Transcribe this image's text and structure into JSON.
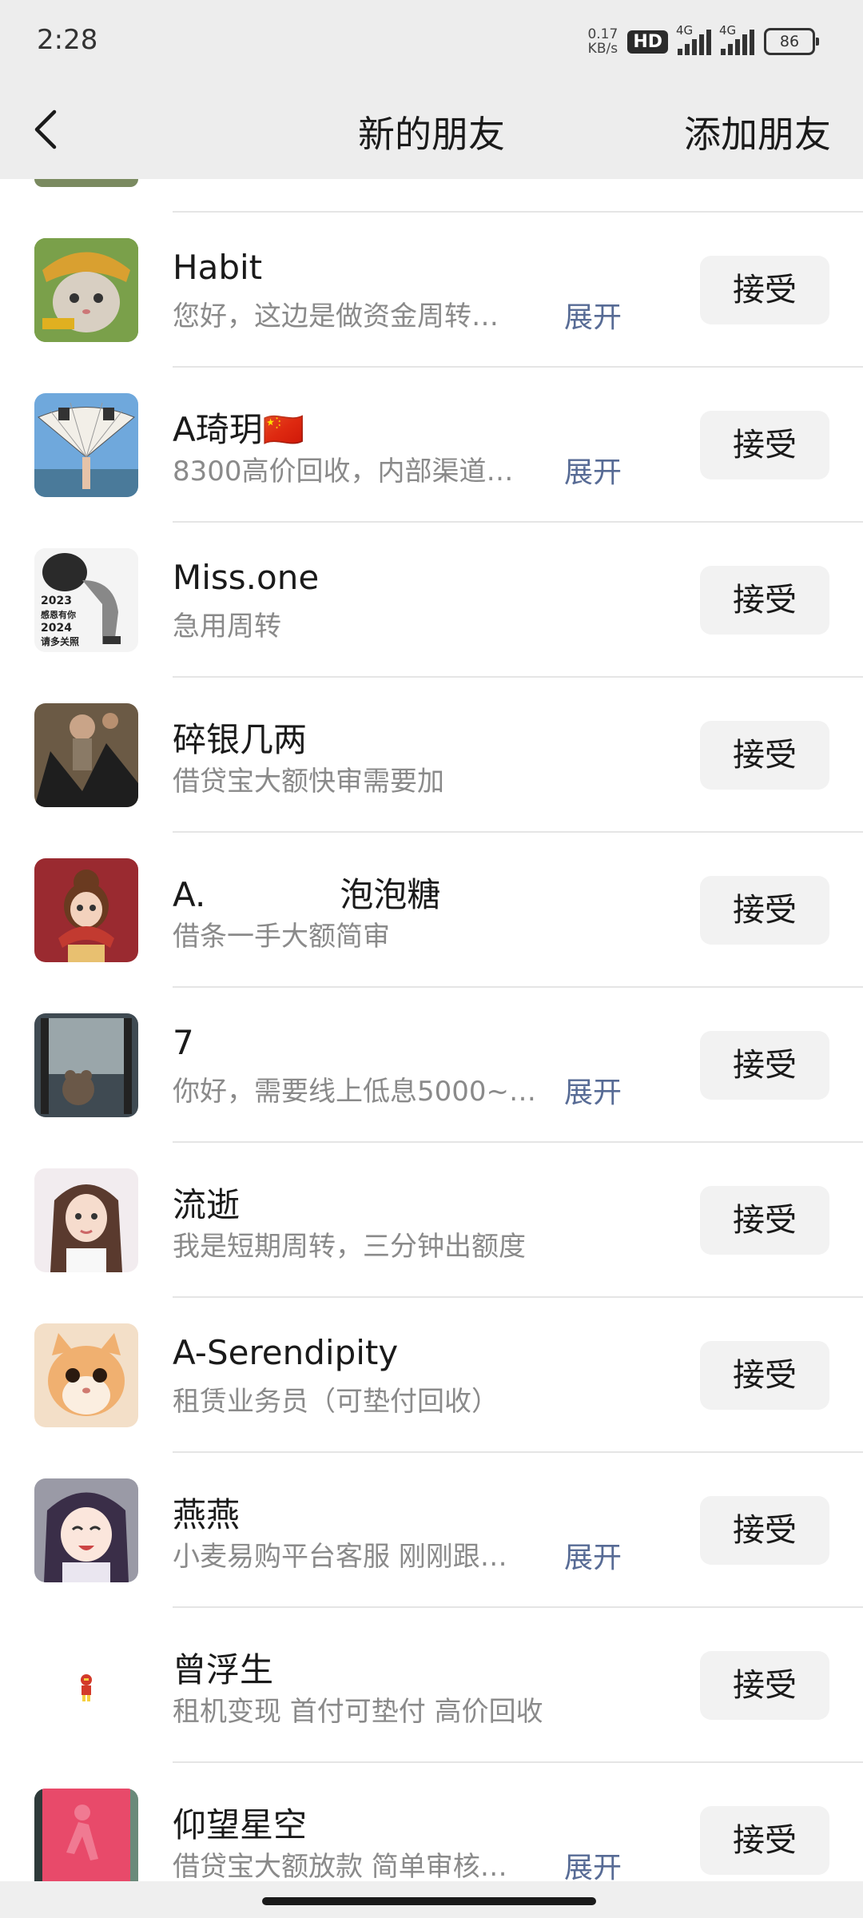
{
  "status_bar": {
    "time": "2:28",
    "net_speed_value": "0.17",
    "net_speed_unit": "KB/s",
    "hd_badge": "HD",
    "signal_1_label": "4G",
    "signal_2_label": "4G",
    "battery": "86"
  },
  "nav": {
    "title": "新的朋友",
    "add_label": "添加朋友"
  },
  "requests": [
    {
      "name": "Habit",
      "message": "您好，这边是做资金周转…",
      "expand": "展开",
      "accept": "接受"
    },
    {
      "name": "A琦玥🇨🇳",
      "message": "8300高价回收，内部渠道…",
      "expand": "展开",
      "accept": "接受"
    },
    {
      "name": "Miss.one",
      "message": "急用周转",
      "expand": "",
      "accept": "接受"
    },
    {
      "name": "碎银几两",
      "message": "借贷宝大额快审需要加",
      "expand": "",
      "accept": "接受"
    },
    {
      "name": "A.　　　　泡泡糖",
      "message": "借条一手大额简审",
      "expand": "",
      "accept": "接受"
    },
    {
      "name": "7",
      "message": "你好，需要线上低息5000~…",
      "expand": "展开",
      "accept": "接受"
    },
    {
      "name": "流逝",
      "message": "我是短期周转，三分钟出额度",
      "expand": "",
      "accept": "接受"
    },
    {
      "name": "A-Serendipity",
      "message": "租赁业务员（可垫付回收）",
      "expand": "",
      "accept": "接受"
    },
    {
      "name": "燕燕",
      "message": "小麦易购平台客服 刚刚跟…",
      "expand": "展开",
      "accept": "接受"
    },
    {
      "name": "曾浮生",
      "message": "租机变现 首付可垫付 高价回收",
      "expand": "",
      "accept": "接受"
    },
    {
      "name": "仰望星空",
      "message": "借贷宝大额放款 简单审核…",
      "expand": "展开",
      "accept": "接受"
    }
  ],
  "avatar_texts": {
    "miss_one_line1": "2023",
    "miss_one_line2": "感恩有你",
    "miss_one_line3": "2024",
    "miss_one_line4": "请多关照"
  },
  "colors": {
    "link": "#576b95",
    "bar_bg": "#ededed",
    "button_bg": "#f2f2f2"
  }
}
